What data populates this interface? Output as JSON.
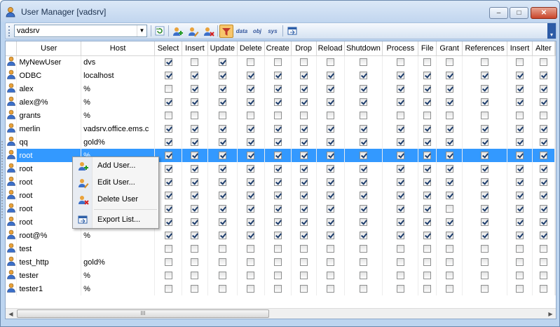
{
  "window": {
    "title": "User Manager [vadsrv]",
    "min": "–",
    "max": "□",
    "close": "✕"
  },
  "toolbar": {
    "server": "vadsrv",
    "buttons": [
      {
        "name": "refresh-button",
        "icon": "refresh-icon"
      },
      {
        "name": "add-user-button",
        "icon": "add-user-icon"
      },
      {
        "name": "edit-user-button",
        "icon": "edit-user-icon"
      },
      {
        "name": "delete-user-button",
        "icon": "delete-user-icon"
      },
      {
        "name": "filter-button",
        "icon": "filter-icon",
        "active": true
      },
      {
        "name": "data-privileges-button",
        "label": "data"
      },
      {
        "name": "object-privileges-button",
        "label": "obj"
      },
      {
        "name": "system-privileges-button",
        "label": "sys"
      },
      {
        "name": "export-button",
        "icon": "export-icon"
      }
    ]
  },
  "grid": {
    "columns": [
      "User",
      "Host",
      "Select",
      "Insert",
      "Update",
      "Delete",
      "Create",
      "Drop",
      "Reload",
      "Shutdown",
      "Process",
      "File",
      "Grant",
      "References",
      "Insert",
      "Alter"
    ],
    "rows": [
      {
        "user": "MyNewUser",
        "host": "dvs",
        "privs": [
          1,
          0,
          1,
          0,
          0,
          0,
          0,
          0,
          0,
          0,
          0,
          0,
          0,
          0
        ]
      },
      {
        "user": "ODBC",
        "host": "localhost",
        "privs": [
          1,
          1,
          1,
          1,
          1,
          1,
          1,
          1,
          1,
          1,
          1,
          1,
          1,
          1
        ]
      },
      {
        "user": "alex",
        "host": "%",
        "privs": [
          0,
          1,
          1,
          1,
          1,
          1,
          1,
          1,
          1,
          1,
          1,
          1,
          1,
          1
        ]
      },
      {
        "user": "alex@%",
        "host": "%",
        "privs": [
          1,
          1,
          1,
          1,
          1,
          1,
          1,
          1,
          1,
          1,
          1,
          1,
          1,
          1
        ]
      },
      {
        "user": "grants",
        "host": "%",
        "privs": [
          0,
          0,
          0,
          0,
          0,
          0,
          0,
          0,
          0,
          0,
          0,
          0,
          0,
          0
        ]
      },
      {
        "user": "merlin",
        "host": "vadsrv.office.ems.c",
        "privs": [
          1,
          1,
          1,
          1,
          1,
          1,
          1,
          1,
          1,
          1,
          1,
          1,
          1,
          1
        ]
      },
      {
        "user": "qq",
        "host": "gold%",
        "privs": [
          1,
          1,
          1,
          1,
          1,
          1,
          1,
          1,
          1,
          1,
          1,
          1,
          1,
          1
        ]
      },
      {
        "user": "root",
        "host": "%",
        "selected": true,
        "privs": [
          1,
          1,
          1,
          1,
          1,
          1,
          1,
          1,
          1,
          1,
          1,
          1,
          1,
          1
        ]
      },
      {
        "user": "root",
        "host": "",
        "privs": [
          1,
          1,
          1,
          1,
          1,
          1,
          1,
          1,
          1,
          1,
          1,
          1,
          1,
          1
        ]
      },
      {
        "user": "root",
        "host": "",
        "privs": [
          1,
          1,
          1,
          1,
          1,
          1,
          1,
          1,
          1,
          1,
          1,
          1,
          1,
          1
        ]
      },
      {
        "user": "root",
        "host": "",
        "privs": [
          1,
          1,
          1,
          1,
          1,
          1,
          1,
          1,
          1,
          1,
          1,
          1,
          1,
          1
        ]
      },
      {
        "user": "root",
        "host": "",
        "privs": [
          1,
          1,
          1,
          1,
          1,
          1,
          1,
          1,
          1,
          1,
          0,
          1,
          1,
          1
        ]
      },
      {
        "user": "root",
        "host": "",
        "privs": [
          1,
          1,
          1,
          1,
          1,
          1,
          1,
          1,
          1,
          1,
          1,
          1,
          1,
          1
        ]
      },
      {
        "user": "root@%",
        "host": "%",
        "privs": [
          1,
          1,
          1,
          1,
          1,
          1,
          1,
          1,
          1,
          1,
          1,
          1,
          1,
          1
        ]
      },
      {
        "user": "test",
        "host": "",
        "privs": [
          0,
          0,
          0,
          0,
          0,
          0,
          0,
          0,
          0,
          0,
          0,
          0,
          0,
          0
        ]
      },
      {
        "user": "test_http",
        "host": "gold%",
        "privs": [
          0,
          0,
          0,
          0,
          0,
          0,
          0,
          0,
          0,
          0,
          0,
          0,
          0,
          0
        ]
      },
      {
        "user": "tester",
        "host": "%",
        "privs": [
          0,
          0,
          0,
          0,
          0,
          0,
          0,
          0,
          0,
          0,
          0,
          0,
          0,
          0
        ]
      },
      {
        "user": "tester1",
        "host": "%",
        "privs": [
          0,
          0,
          0,
          0,
          0,
          0,
          0,
          0,
          0,
          0,
          0,
          0,
          0,
          0
        ]
      }
    ],
    "scroll_thumb": "III"
  },
  "context_menu": {
    "items": [
      {
        "label": "Add User...",
        "icon": "add-user-icon"
      },
      {
        "label": "Edit User...",
        "icon": "edit-user-icon"
      },
      {
        "label": "Delete User",
        "icon": "delete-user-icon"
      },
      {
        "label": "Export List...",
        "icon": "export-icon"
      }
    ]
  }
}
